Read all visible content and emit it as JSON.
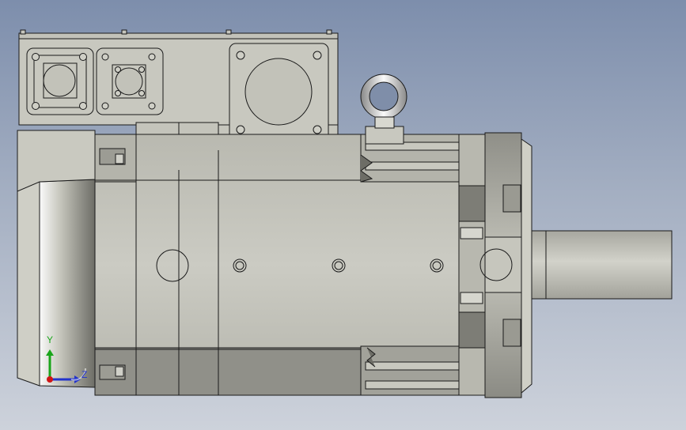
{
  "viewport": {
    "background_top": "#7d8eac",
    "background_bottom": "#cdd2db",
    "model_fill": "#c6c6bd",
    "model_shadow": "#8d8d85",
    "model_edge": "#1a1a1a"
  },
  "triad": {
    "y_label": "Y",
    "z_label": "Z",
    "y_color": "#1aa51a",
    "z_color": "#2233cc",
    "x_color": "#d01515"
  },
  "model": {
    "part": "servo-motor",
    "icons": [
      "lifting-eye-bolt-icon",
      "connector-socket-icon",
      "shaft-icon"
    ]
  }
}
